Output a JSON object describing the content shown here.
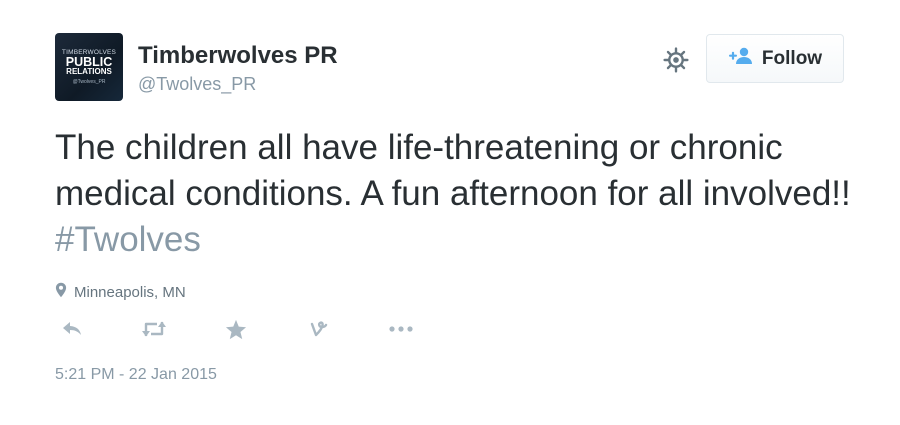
{
  "user": {
    "name": "Timberwolves PR",
    "handle": "@Twolves_PR",
    "avatar": {
      "line1": "TIMBERWOLVES",
      "line2": "PUBLIC",
      "line3": "RELATIONS",
      "line4": "@Twolves_PR"
    }
  },
  "follow_button": {
    "label": "Follow",
    "icon": "add-user-icon"
  },
  "settings_icon": "gear-icon",
  "tweet": {
    "text": "The children all have life-threatening or chronic medical conditions. A fun afternoon for all involved!!",
    "hashtag": "#Twolves"
  },
  "location": {
    "text": "Minneapolis, MN",
    "icon": "location-pin-icon"
  },
  "actions": [
    {
      "name": "reply",
      "icon": "reply-icon"
    },
    {
      "name": "retweet",
      "icon": "retweet-icon"
    },
    {
      "name": "favorite",
      "icon": "star-icon"
    },
    {
      "name": "vine",
      "icon": "vine-icon"
    },
    {
      "name": "more",
      "icon": "more-icon"
    }
  ],
  "timestamp": "5:21 PM - 22 Jan 2015",
  "colors": {
    "text": "#292f33",
    "muted": "#8899a6",
    "accent": "#55acee",
    "icon": "#aab8c2"
  }
}
